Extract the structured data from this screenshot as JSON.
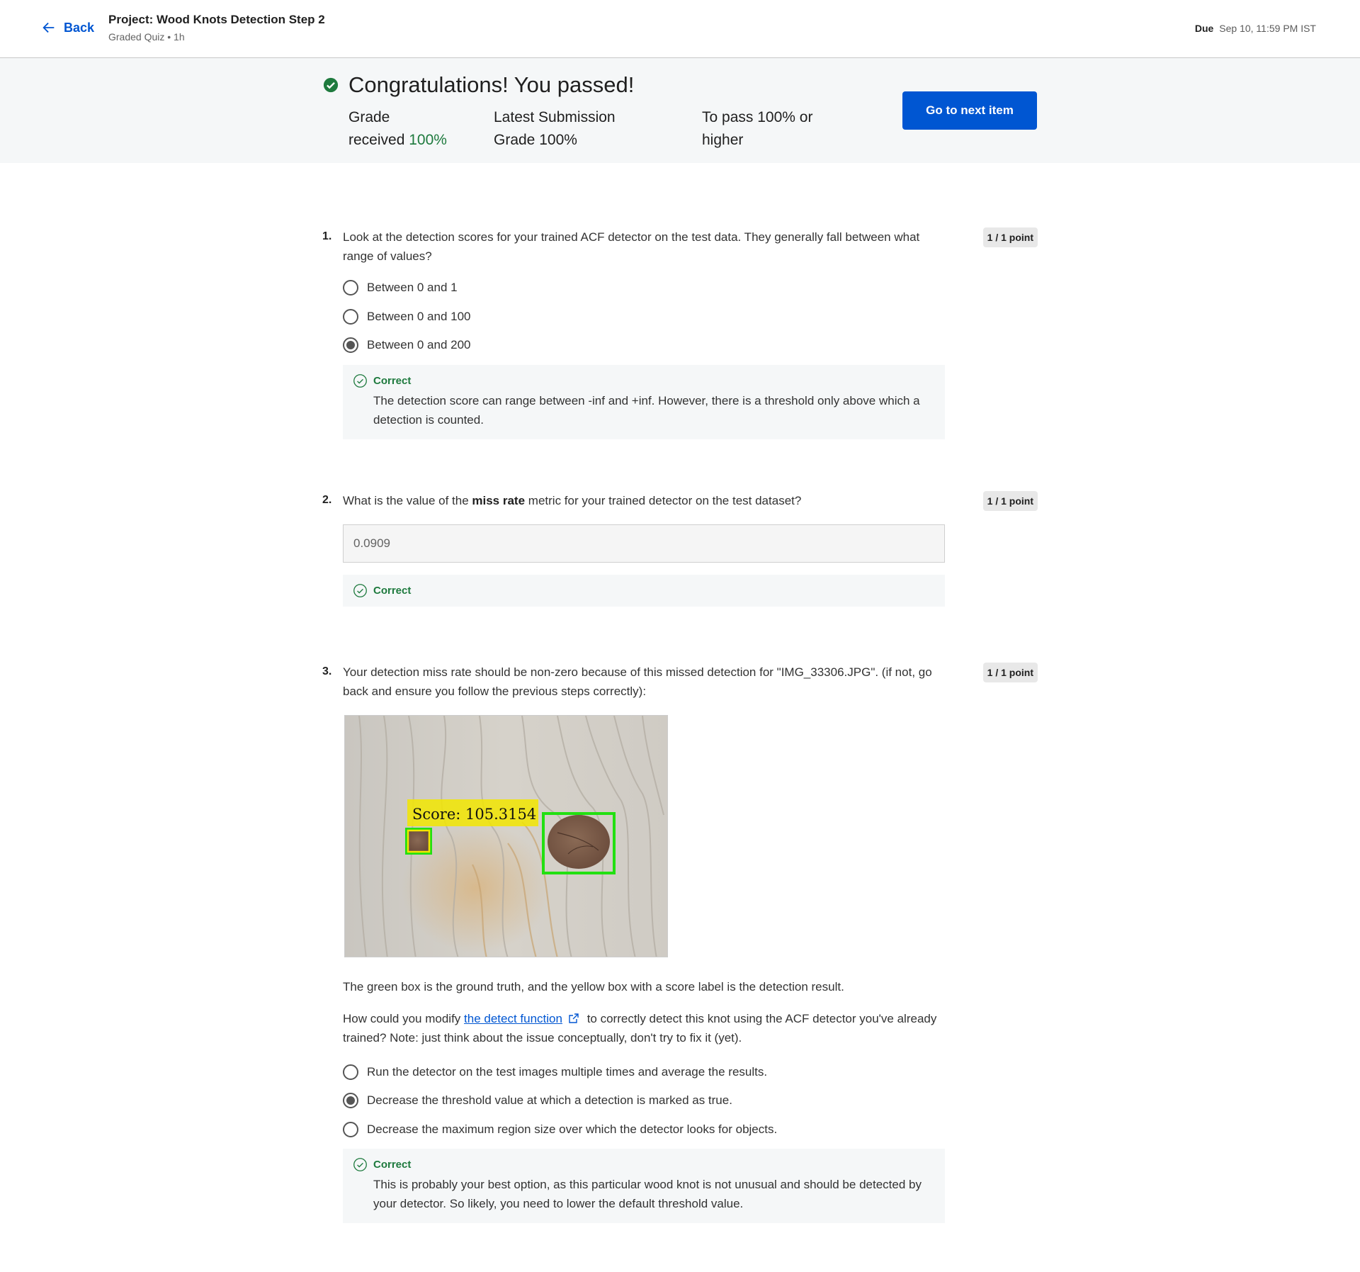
{
  "header": {
    "back_label": "Back",
    "project_title": "Project: Wood Knots Detection Step 2",
    "project_subtitle": "Graded Quiz • 1h",
    "due_label": "Due",
    "due_value": "Sep 10, 11:59 PM IST"
  },
  "banner": {
    "congrats": "Congratulations! You passed!",
    "grade_line1": "Grade",
    "grade_line2": "received",
    "grade_value": "100%",
    "latest_line1": "Latest Submission",
    "latest_line2": "Grade",
    "latest_value": "100%",
    "pass_line1": "To pass",
    "pass_value": "100% or",
    "pass_line2": "higher",
    "next_button": "Go to next item"
  },
  "questions": [
    {
      "number": "1.",
      "points": "1 / 1 point",
      "text": "Look at the detection scores for your trained ACF detector on the test data. They generally fall between what range of values?",
      "options": [
        {
          "label": "Between 0 and 1",
          "selected": false
        },
        {
          "label": "Between 0 and 100",
          "selected": false
        },
        {
          "label": "Between 0 and 200",
          "selected": true
        }
      ],
      "feedback_title": "Correct",
      "feedback_body": "The detection score can range between -inf and +inf. However, there is a threshold only above which a detection is counted."
    },
    {
      "number": "2.",
      "points": "1 / 1 point",
      "text_before": "What is the value of the ",
      "text_bold": "miss rate",
      "text_after": " metric for your trained detector on the test dataset?",
      "answer": "0.0909",
      "feedback_title": "Correct"
    },
    {
      "number": "3.",
      "points": "1 / 1 point",
      "text": "Your detection miss rate should be non-zero because of this missed detection for \"IMG_33306.JPG\". (if not, go back and ensure you follow the previous steps correctly):",
      "image_score_label": "Score: 105.3154",
      "caption": "The green box is the ground truth, and the yellow box with a score label is the detection result.",
      "prompt_before": "How could you modify ",
      "prompt_link": "the detect function",
      "prompt_after": " to correctly detect this knot using the ACF detector you've already trained? Note:  just think about the issue conceptually, don't try to fix it (yet).",
      "options": [
        {
          "label": "Run the detector on the test images multiple times and average the results.",
          "selected": false
        },
        {
          "label": "Decrease the threshold value at which a detection is marked as true.",
          "selected": true
        },
        {
          "label": "Decrease the maximum region size over which the detector looks for objects.",
          "selected": false
        }
      ],
      "feedback_title": "Correct",
      "feedback_body": "This is probably your best option, as this particular wood knot is not unusual and should be detected by your detector. So likely, you need to lower the default threshold value."
    }
  ],
  "icons": {
    "back": "arrow-left-icon",
    "passed": "check-circle-filled-icon",
    "correct": "check-circle-outline-icon",
    "external": "external-link-icon"
  },
  "colors": {
    "accent": "#0056d2",
    "success": "#1e7a3e",
    "detection_box": "#f2e600",
    "ground_truth_box": "#22e011"
  }
}
